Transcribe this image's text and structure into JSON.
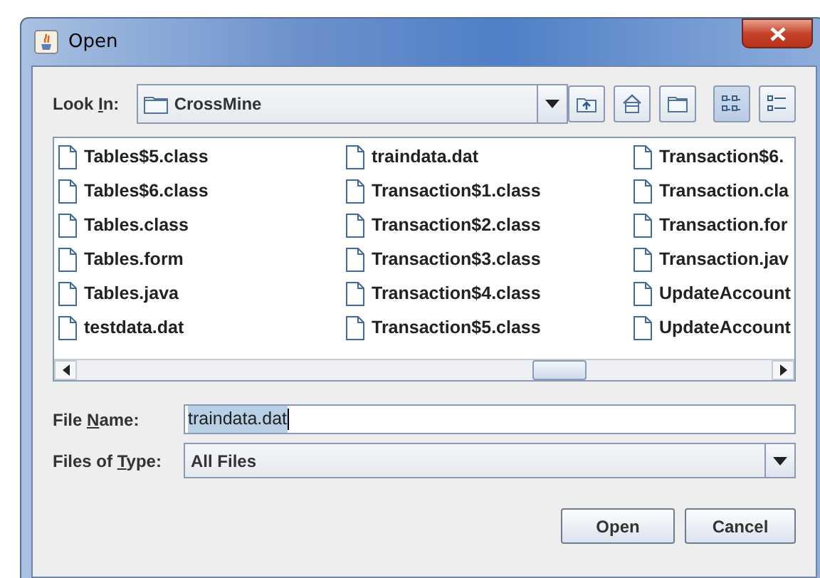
{
  "window": {
    "title": "Open"
  },
  "look_in": {
    "label": {
      "before": "Look ",
      "key": "I",
      "after": "n:"
    },
    "value": "CrossMine"
  },
  "toolbar": [
    {
      "kind": "up",
      "selected": false
    },
    {
      "kind": "home",
      "selected": false
    },
    {
      "kind": "newfolder",
      "selected": false
    },
    {
      "kind": "list",
      "selected": true
    },
    {
      "kind": "details",
      "selected": false
    }
  ],
  "files": [
    [
      "Tables$5.class",
      "Tables$6.class",
      "Tables.class",
      "Tables.form",
      "Tables.java",
      "testdata.dat"
    ],
    [
      "traindata.dat",
      "Transaction$1.class",
      "Transaction$2.class",
      "Transaction$3.class",
      "Transaction$4.class",
      "Transaction$5.class"
    ],
    [
      "Transaction$6.",
      "Transaction.cla",
      "Transaction.for",
      "Transaction.jav",
      "UpdateAccount",
      "UpdateAccount"
    ]
  ],
  "file_name": {
    "label": {
      "before": "File ",
      "key": "N",
      "after": "ame:"
    },
    "value": "traindata.dat",
    "text_selected": true
  },
  "file_type": {
    "label": {
      "before": "Files of ",
      "key": "T",
      "after": "ype:"
    },
    "value": "All Files"
  },
  "buttons": [
    "Open",
    "Cancel"
  ]
}
